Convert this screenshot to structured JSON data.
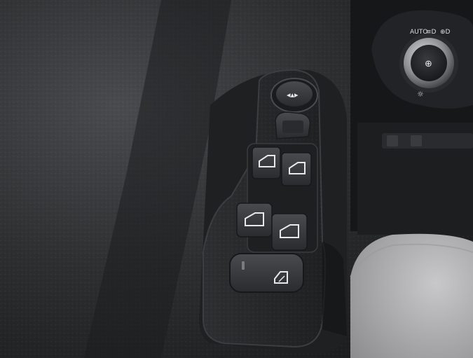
{
  "photo": {
    "subject": "driver door window control panel",
    "dial_labels": {
      "auto": "AUTO",
      "beam": "≡D",
      "fog": "⊕D"
    },
    "colors": {
      "door_trim": "#2a2b2d",
      "panel": "#262729",
      "switch": "#3a3b3e",
      "seat_fabric": "#b9b9bb",
      "dial_ring": "#9a9ca0"
    },
    "icons": [
      "mirror-joystick-icon",
      "window-up-down-icon",
      "child-lock-icon",
      "headlight-icon",
      "fog-light-icon",
      "sun-icon"
    ]
  }
}
